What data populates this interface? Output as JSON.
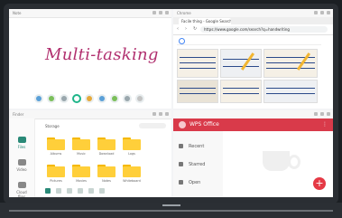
{
  "whiteboard": {
    "window_title": "Note",
    "handwriting": "Multi-tasking",
    "tools": [
      "pen-icon",
      "marker-icon",
      "eraser-icon",
      "select-icon",
      "shape-icon",
      "undo-icon",
      "redo-icon",
      "insert-icon",
      "more-icon"
    ]
  },
  "browser": {
    "window_title": "Chrome",
    "tab_title": "Facile thing - Google Search",
    "url": "https://www.google.com/search?q=handwriting"
  },
  "file_manager": {
    "window_title": "Finder",
    "section_label": "Storage",
    "sidebar": [
      {
        "label": "Files"
      },
      {
        "label": "Video"
      },
      {
        "label": "Cloud files"
      }
    ],
    "folders": [
      {
        "name": "Albums"
      },
      {
        "name": "Music"
      },
      {
        "name": "Download"
      },
      {
        "name": "Logs"
      },
      {
        "name": "Pictures"
      },
      {
        "name": "Movies"
      },
      {
        "name": "Notes"
      },
      {
        "name": "Whiteboard"
      }
    ]
  },
  "wps": {
    "title": "WPS Office",
    "menu": [
      {
        "label": "Recent"
      },
      {
        "label": "Starred"
      },
      {
        "label": "Open"
      }
    ],
    "fab_label": "+"
  },
  "colors": {
    "accent_teal": "#1fb58a",
    "wps_red": "#d93a4a",
    "handwriting": "#b1306f",
    "folder_yellow": "#ffcf3a"
  }
}
